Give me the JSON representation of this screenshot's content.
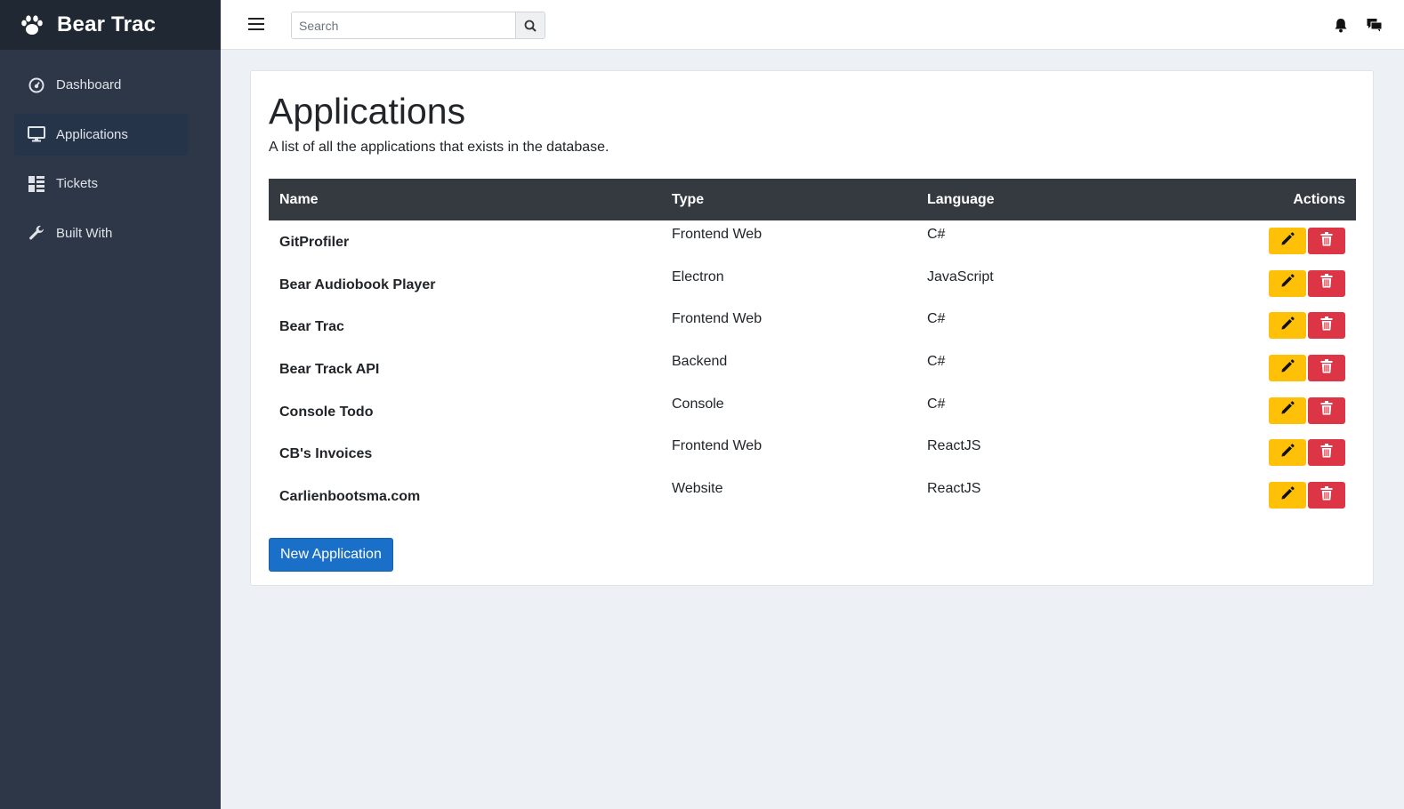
{
  "brand": {
    "name": "Bear Trac",
    "icon": "paw-icon"
  },
  "sidebar": {
    "items": [
      {
        "label": "Dashboard",
        "icon": "dashboard-icon",
        "active": false
      },
      {
        "label": "Applications",
        "icon": "monitor-icon",
        "active": true
      },
      {
        "label": "Tickets",
        "icon": "tickets-icon",
        "active": false
      },
      {
        "label": "Built With",
        "icon": "wrench-icon",
        "active": false
      }
    ]
  },
  "topbar": {
    "search_placeholder": "Search",
    "icons": [
      "menu-icon",
      "search-icon",
      "bell-icon",
      "messages-icon"
    ]
  },
  "main": {
    "title": "Applications",
    "description": "A list of all the applications that exists in the database.",
    "table": {
      "headers": {
        "name": "Name",
        "type": "Type",
        "language": "Language",
        "actions": "Actions"
      },
      "rows": [
        {
          "name": "GitProfiler",
          "type": "Frontend Web",
          "language": "C#"
        },
        {
          "name": "Bear Audiobook Player",
          "type": "Electron",
          "language": "JavaScript"
        },
        {
          "name": "Bear Trac",
          "type": "Frontend Web",
          "language": "C#"
        },
        {
          "name": "Bear Track API",
          "type": "Backend",
          "language": "C#"
        },
        {
          "name": "Console Todo",
          "type": "Console",
          "language": "C#"
        },
        {
          "name": "CB's Invoices",
          "type": "Frontend Web",
          "language": "ReactJS"
        },
        {
          "name": "Carlienbootsma.com",
          "type": "Website",
          "language": "ReactJS"
        }
      ]
    },
    "new_button": "New Application"
  },
  "colors": {
    "sidebar_bg": "#2d3748",
    "brand_bg": "#202833",
    "table_header_bg": "#343a40",
    "edit_button": "#ffc107",
    "delete_button": "#dc3545",
    "primary": "#1a6fc9"
  }
}
